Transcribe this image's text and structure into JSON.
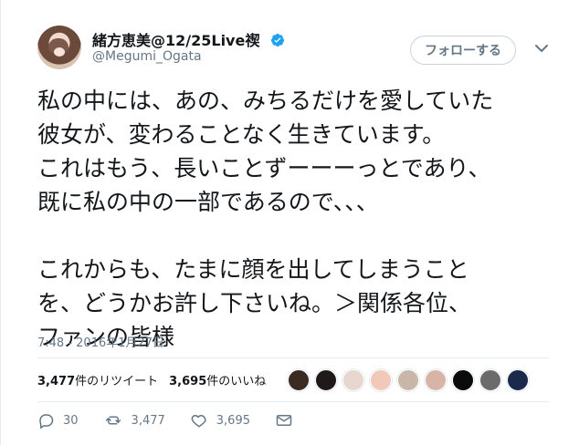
{
  "user": {
    "display_name": "緒方恵美@12/25Live禊",
    "handle": "@Megumi_Ogata"
  },
  "follow_button": "フォローする",
  "tweet": {
    "text": "私の中には、あの、みちるだけを愛していた\n彼女が、変わることなく生きています。\nこれはもう、長いことずーーーっとであり、\n既に私の中の一部であるので、、、\n\nこれからも、たまに顔を出してしまうこと\nを、どうかお許し下さいね。＞関係各位、\nファンの皆様",
    "timestamp": "7:48 - 2016年1月27日"
  },
  "stats": {
    "retweets_count": "3,477",
    "retweets_label": "件のリツイート",
    "likes_count": "3,695",
    "likes_label": "件のいいね"
  },
  "actions": {
    "replies": "30",
    "retweets": "3,477",
    "likes": "3,695"
  },
  "liker_avatars": [
    {
      "color": "#3b2b22"
    },
    {
      "color": "#1f1a18"
    },
    {
      "color": "#e7d7cf"
    },
    {
      "color": "#f2c9b8"
    },
    {
      "color": "#c9b6a8"
    },
    {
      "color": "#d7b4a7"
    },
    {
      "color": "#0b0b0b"
    },
    {
      "color": "#6b6b6b"
    },
    {
      "color": "#1b2a4a"
    }
  ],
  "colors": {
    "text": "#14171a",
    "muted": "#657786",
    "border": "#e6ecf0",
    "verified": "#1da1f2"
  }
}
